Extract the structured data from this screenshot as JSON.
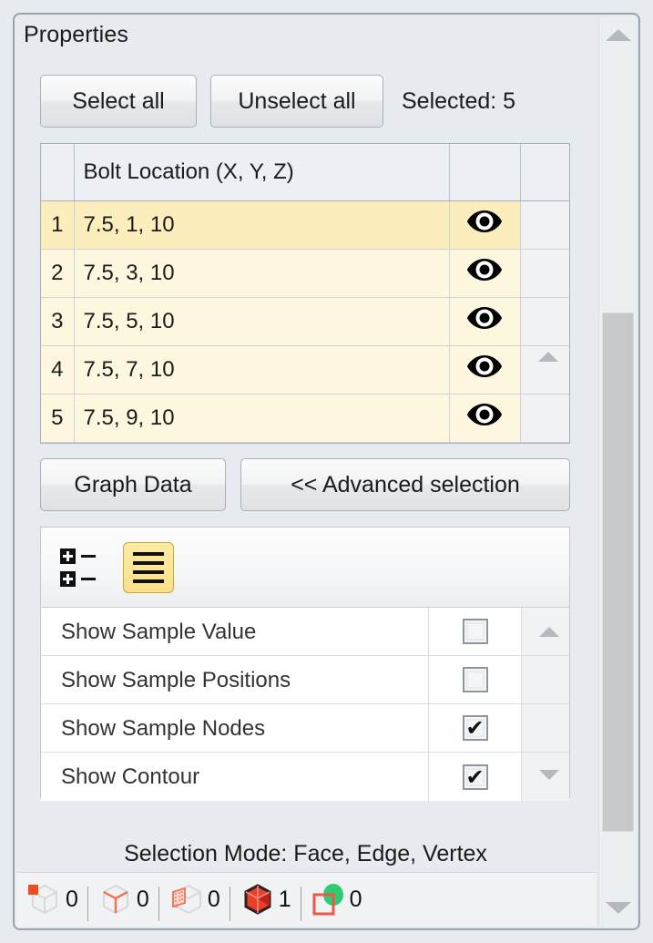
{
  "panel": {
    "title": "Properties"
  },
  "toolbar": {
    "select_all_label": "Select all",
    "unselect_all_label": "Unselect all",
    "selected_count_label": "Selected: 5",
    "graph_data_label": "Graph Data",
    "advanced_selection_label": "<< Advanced selection"
  },
  "bolt_table": {
    "columns": [
      "",
      "Bolt Location (X, Y, Z)",
      "",
      ""
    ],
    "rows": [
      {
        "index": "1",
        "location": "7.5, 1, 10",
        "visibility_icon": "eye-icon",
        "selected": true
      },
      {
        "index": "2",
        "location": "7.5, 3, 10",
        "visibility_icon": "eye-icon",
        "selected": false
      },
      {
        "index": "3",
        "location": "7.5, 5, 10",
        "visibility_icon": "eye-icon",
        "selected": false
      },
      {
        "index": "4",
        "location": "7.5, 7, 10",
        "visibility_icon": "eye-icon",
        "selected": false
      },
      {
        "index": "5",
        "location": "7.5, 9, 10",
        "visibility_icon": "eye-icon",
        "selected": false
      }
    ]
  },
  "options": {
    "view_buttons": [
      {
        "name": "tree-view-icon",
        "label": "",
        "active": false
      },
      {
        "name": "list-view-icon",
        "label": "",
        "active": true
      }
    ],
    "rows": [
      {
        "label": "Show Sample Value",
        "checked": false,
        "mark": ""
      },
      {
        "label": "Show Sample Positions",
        "checked": false,
        "mark": ""
      },
      {
        "label": "Show Sample Nodes",
        "checked": true,
        "mark": "✔"
      },
      {
        "label": "Show Contour",
        "checked": true,
        "mark": "✔"
      }
    ]
  },
  "status": {
    "selection_mode_label": "Selection Mode:  Face, Edge, Vertex",
    "counters": [
      {
        "icon": "vertex-selection-icon",
        "count": "0"
      },
      {
        "icon": "edge-selection-icon",
        "count": "0"
      },
      {
        "icon": "face-selection-icon",
        "count": "0"
      },
      {
        "icon": "body-selection-icon",
        "count": "1"
      },
      {
        "icon": "named-selection-icon",
        "count": "0"
      }
    ]
  },
  "colors": {
    "panel_background": "#e7ebf0",
    "row_selected": "#fbeebc",
    "row_normal": "#fdf7e0",
    "accent_yellow": "#fbe08a",
    "accent_red": "#e8412a",
    "accent_green": "#2ecc71"
  }
}
